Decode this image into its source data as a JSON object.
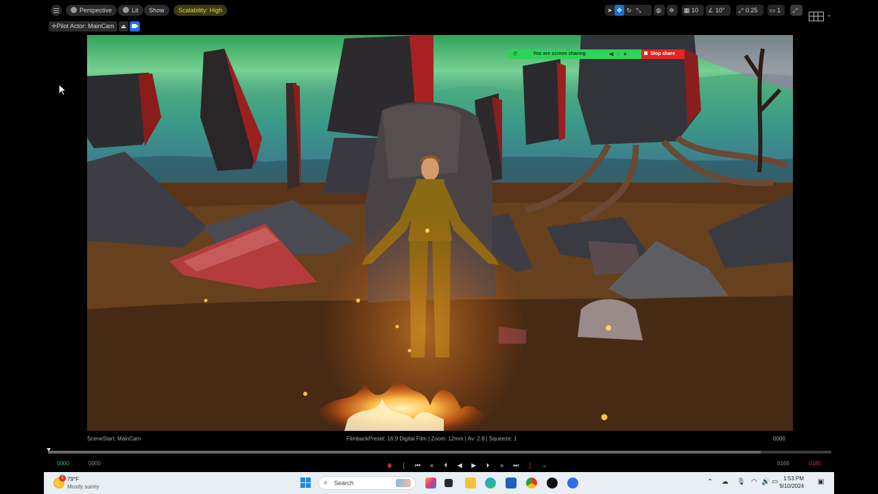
{
  "viewport_toolbar": {
    "perspective_label": "Perspective",
    "lit_label": "Lit",
    "show_label": "Show",
    "scalability_label": "Scalability: High",
    "grid_value": "10",
    "angle_value": "10°",
    "scale_value": "0.25",
    "camera_speed": "1"
  },
  "pilot": {
    "label": "Pilot Actor: MainCam"
  },
  "screen_share": {
    "status_text": "You are screen sharing",
    "stop_label": "Stop share"
  },
  "viewport_status": {
    "camera_name": "SceneStart: MainCam",
    "filmback": "FilmbackPreset: 16:9 Digital Film | Zoom: 12mm | Av: 2.8 | Squeeze: 1",
    "current_frame": "0000"
  },
  "timeline": {
    "start_green": "0000",
    "start": "0000",
    "end": "0165",
    "end_red": "0180",
    "progress": 0.91
  },
  "taskbar": {
    "notification_count": "1",
    "temperature": "79°F",
    "weather_desc": "Mostly sunny",
    "search_placeholder": "Search",
    "time": "1:53 PM",
    "date": "9/10/2024"
  }
}
